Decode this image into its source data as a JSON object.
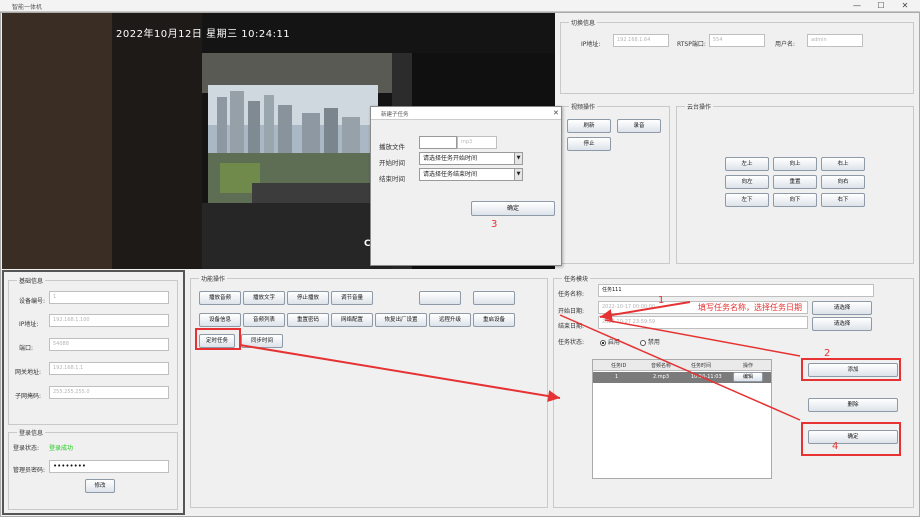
{
  "window": {
    "title": "智能一体机",
    "min": "—",
    "max": "☐",
    "close": "✕"
  },
  "video": {
    "timestamp": "2022年10月12日 星期三 10:24:11"
  },
  "conn_panel": {
    "title": "切换信息",
    "ip_label": "IP地址:",
    "ip_value": "192.168.1.64",
    "rtsp_label": "RTSP端口:",
    "rtsp_value": "554",
    "user_label": "用户名:",
    "user_value": "admin"
  },
  "video_ops": {
    "title": "视频操作",
    "btn_refresh": "刷新",
    "btn_record": "录音",
    "btn_stop": "停止"
  },
  "ptz": {
    "title": "云台操作",
    "buttons": [
      "左上",
      "向上",
      "右上",
      "向左",
      "重置",
      "向右",
      "左下",
      "向下",
      "右下"
    ]
  },
  "device_info": {
    "title": "基础信息",
    "fields": [
      {
        "label": "设备编号:",
        "value": "1"
      },
      {
        "label": "IP地址:",
        "value": "192.168.1.100"
      },
      {
        "label": "端口:",
        "value": "54088"
      },
      {
        "label": "网关地址:",
        "value": "192.168.1.1"
      },
      {
        "label": "子网掩码:",
        "value": "255.255.255.0"
      }
    ]
  },
  "login": {
    "title": "登录信息",
    "status_label": "登录状态:",
    "status_value": "登录成功",
    "status_color": "#22cc22",
    "pwd_label": "管理员密码:",
    "pwd_value": "••••••••",
    "btn": "修改"
  },
  "func_ops": {
    "title": "功能操作",
    "row1": [
      "播放音频",
      "播放文字",
      "停止播放",
      "调节音量",
      "",
      "",
      ""
    ],
    "row2": [
      "设备信息",
      "音频列表",
      "重置密码",
      "网络配置",
      "恢复出厂设置",
      "远程升级",
      "重启设备"
    ],
    "row3": [
      "定时任务",
      "同步时间"
    ]
  },
  "dialog": {
    "title": "新建子任务",
    "close": "✕",
    "file_label": "播放文件",
    "file_value": "mp3",
    "start_label": "开始时间",
    "start_placeholder": "请选择任务开始时间",
    "end_label": "结束时间",
    "end_placeholder": "请选择任务结束时间",
    "ok": "确定"
  },
  "task_panel": {
    "title": "任务模块",
    "name_label": "任务名称:",
    "name_value": "任务111",
    "start_label": "开始日期:",
    "start_value": "2022-10-17 00:00:00",
    "end_label": "结束日期:",
    "end_value": "2022-10-27 23:59:59",
    "select_btn": "请选择",
    "status_label": "任务状态:",
    "enabled": "启用",
    "disabled": "禁用",
    "table_headers": [
      "任务ID",
      "音频名称",
      "任务时间",
      "操作"
    ],
    "table_rows": [
      {
        "id": "1",
        "audio": "2.mp3",
        "time": "10:50-11:03",
        "op": "编辑"
      }
    ],
    "btn_add": "添加",
    "btn_delete": "删除",
    "btn_ok": "确定"
  },
  "annotations": {
    "n1": "1",
    "note1": "填写任务名称，选择任务日期",
    "n2": "2",
    "n3": "3",
    "n4": "4",
    "color": "#e63232"
  }
}
